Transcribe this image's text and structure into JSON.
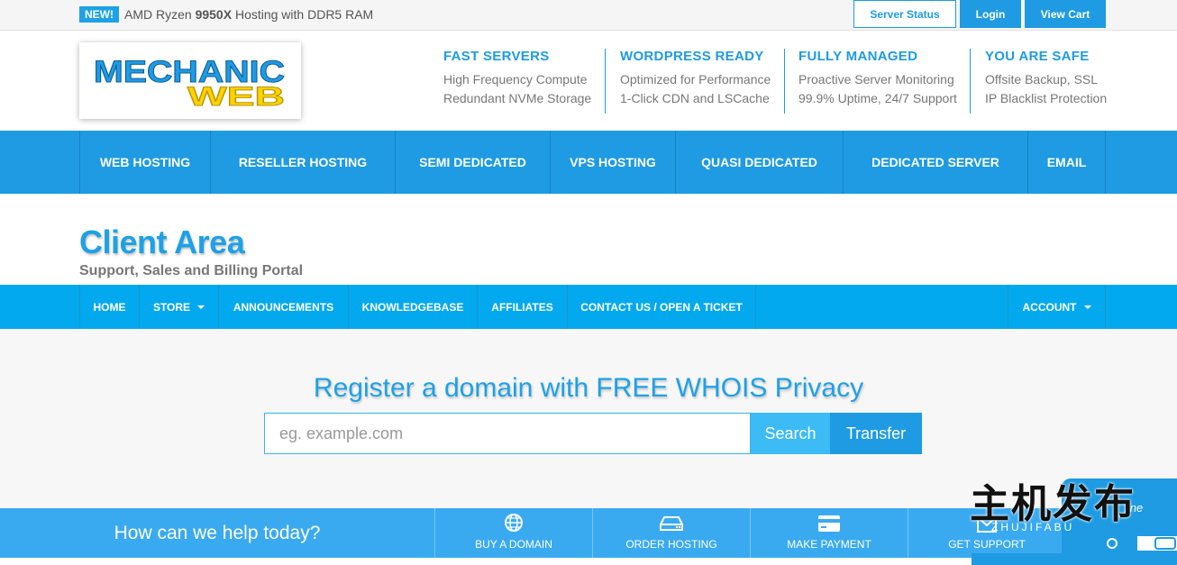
{
  "topbar": {
    "badge": "NEW!",
    "promo_pre": "AMD Ryzen ",
    "promo_bold": "9950X",
    "promo_post": " Hosting with DDR5 RAM",
    "server_status": "Server Status",
    "login": "Login",
    "view_cart": "View Cart"
  },
  "logo": {
    "line1": "MECHANIC",
    "line2": "WEB"
  },
  "features": [
    {
      "title": "FAST SERVERS",
      "line1": "High Frequency Compute",
      "line2": "Redundant NVMe Storage"
    },
    {
      "title": "WORDPRESS READY",
      "line1": "Optimized for Performance",
      "line2": "1-Click CDN and LSCache"
    },
    {
      "title": "FULLY MANAGED",
      "line1": "Proactive Server Monitoring",
      "line2": "99.9% Uptime, 24/7 Support"
    },
    {
      "title": "YOU ARE SAFE",
      "line1": "Offsite Backup, SSL",
      "line2": "IP Blacklist Protection"
    }
  ],
  "mainnav": [
    "WEB HOSTING",
    "RESELLER HOSTING",
    "SEMI DEDICATED",
    "VPS HOSTING",
    "QUASI DEDICATED",
    "DEDICATED SERVER",
    "EMAIL"
  ],
  "client_area": {
    "title": "Client Area",
    "subtitle": "Support, Sales and Billing Portal"
  },
  "subnav": {
    "home": "HOME",
    "store": "STORE",
    "announcements": "ANNOUNCEMENTS",
    "knowledgebase": "KNOWLEDGEBASE",
    "affiliates": "AFFILIATES",
    "contact": "CONTACT US / OPEN A TICKET",
    "account": "ACCOUNT"
  },
  "domain": {
    "heading": "Register a domain with FREE WHOIS Privacy",
    "placeholder": "eg. example.com",
    "value": "",
    "search": "Search",
    "transfer": "Transfer"
  },
  "helpbar": {
    "text": "How can we help today?",
    "buy_domain": "BUY A DOMAIN",
    "order_hosting": "ORDER HOSTING",
    "make_payment": "MAKE PAYMENT",
    "get_support": "GET SUPPORT"
  },
  "chat": {
    "online": "line"
  },
  "watermark": {
    "big": "主机发布",
    "small": "ZHUJIFABU"
  },
  "colors": {
    "primary": "#1e9be2",
    "subnav": "#03a9ee",
    "helpbar": "#3aaaf0",
    "logo_yellow": "#ffd200"
  }
}
